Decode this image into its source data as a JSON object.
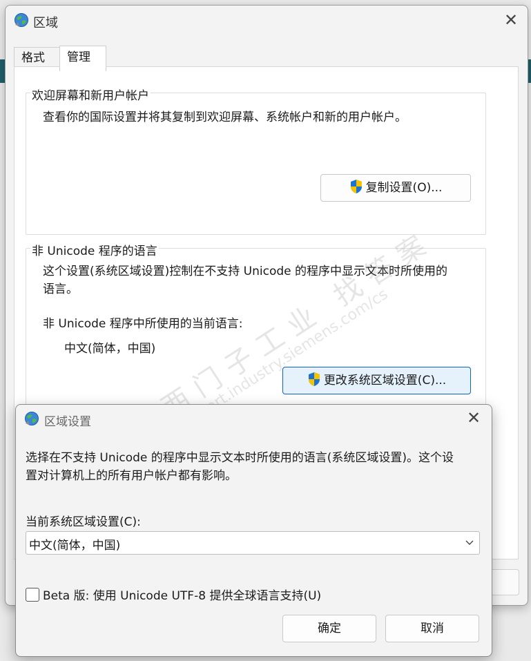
{
  "main_window": {
    "title": "区域",
    "close_glyph": "✕",
    "tabs": [
      {
        "label": "格式",
        "active": false
      },
      {
        "label": "管理",
        "active": true
      }
    ],
    "welcome_group": {
      "legend": "欢迎屏幕和新用户帐户",
      "description": "查看你的国际设置并将其复制到欢迎屏幕、系统帐户和新的用户帐户。",
      "copy_button": "复制设置(O)..."
    },
    "nonunicode_group": {
      "legend": "非 Unicode 程序的语言",
      "description_line1": "这个设置(系统区域设置)控制在不支持 Unicode 的程序中显示文本时所使用的",
      "description_line2": "语言。",
      "current_label": "非 Unicode 程序中所使用的当前语言:",
      "current_value": "中文(简体，中国)",
      "change_button": "更改系统区域设置(C)..."
    },
    "watermark": {
      "line1": "西门子工业 找答案",
      "line2": "support.industry.siemens.com/cs"
    }
  },
  "dialog": {
    "title": "区域设置",
    "close_glyph": "✕",
    "description_line1": "选择在不支持 Unicode 的程序中显示文本时所使用的语言(系统区域设置)。这个设",
    "description_line2": "置对计算机上的所有用户帐户都有影响。",
    "select_label": "当前系统区域设置(C):",
    "select_value": "中文(简体，中国)",
    "beta_checkbox_label": "Beta 版: 使用 Unicode UTF-8 提供全球语言支持(U)",
    "beta_checked": false,
    "ok_button": "确定",
    "cancel_button": "取消"
  },
  "icons": {
    "app_icon": "globe-icon",
    "uac_icon": "uac-shield-icon"
  },
  "colors": {
    "accent": "#0a63c9",
    "shield_blue": "#1e73d2",
    "shield_yellow": "#f5c400"
  }
}
